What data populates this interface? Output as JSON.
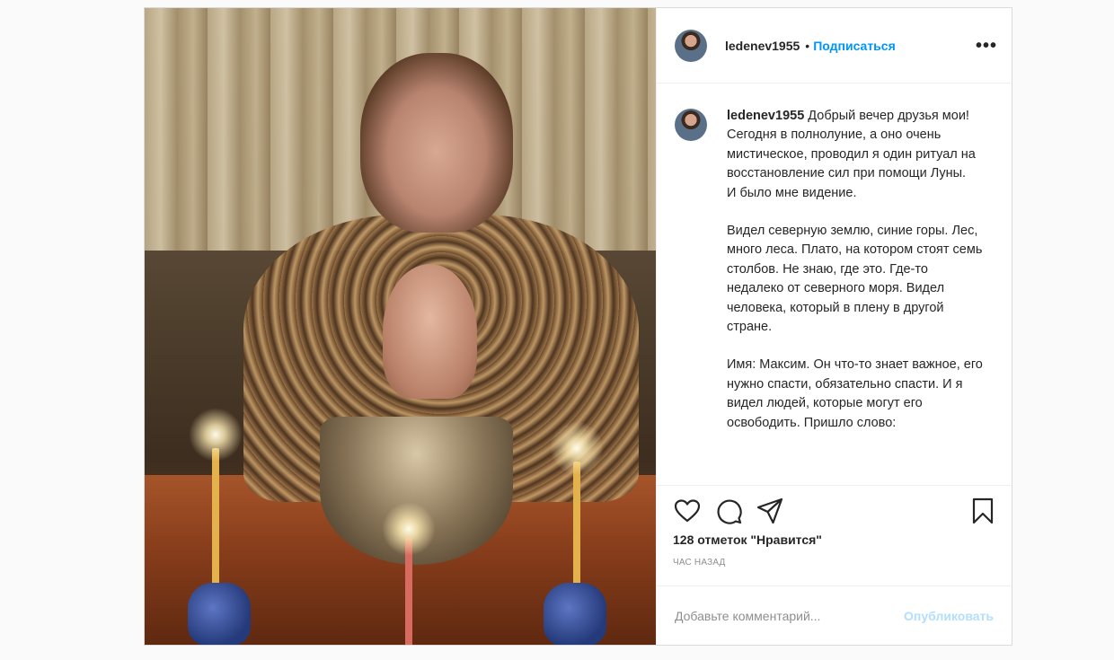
{
  "post": {
    "username": "ledenev1955",
    "separator": "•",
    "follow_label": "Подписаться",
    "more_label": "•••",
    "caption": {
      "username": "ledenev1955",
      "paragraphs": [
        "Добрый вечер друзья мои! Сегодня в полнолуние, а оно очень мистическое, проводил я один ритуал на восстановление сил при помощи Луны.\nИ было мне видение.",
        "Видел северную землю, синие горы. Лес, много леса. Плато, на котором стоят семь столбов. Не знаю, где это. Где-то недалеко от северного моря. Видел человека, который в плену в другой стране.",
        "Имя: Максим. Он что-то знает важное, его нужно спасти, обязательно спасти. И я видел людей, которые могут его освободить. Пришло слово:"
      ]
    },
    "likes": "128 отметок \"Нравится\"",
    "time": "час назад",
    "comment_placeholder": "Добавьте комментарий...",
    "publish_label": "Опубликовать",
    "icons": [
      "heart-icon",
      "comment-icon",
      "share-icon",
      "bookmark-icon",
      "more-icon"
    ]
  }
}
